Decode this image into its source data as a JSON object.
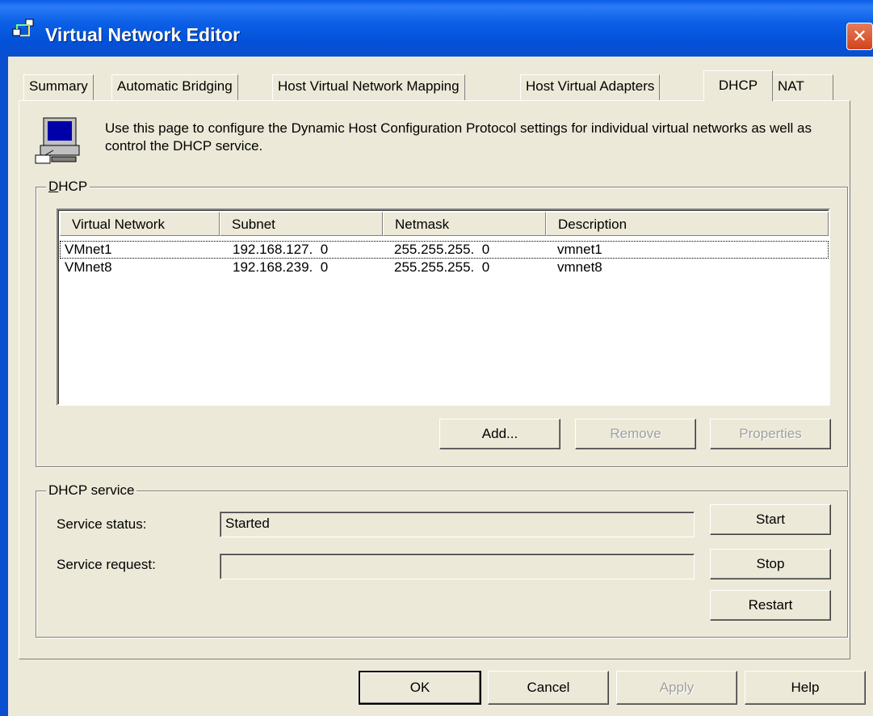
{
  "window": {
    "title": "Virtual Network Editor",
    "close_glyph": "✕"
  },
  "tabs": [
    {
      "label": "Summary"
    },
    {
      "label": "Automatic Bridging"
    },
    {
      "label": "Host Virtual Network Mapping"
    },
    {
      "label": "Host Virtual Adapters"
    },
    {
      "label": "DHCP"
    },
    {
      "label": "NAT"
    }
  ],
  "active_tab": "DHCP",
  "intro": {
    "icon": "network-computer-icon",
    "text": "Use this page to configure the Dynamic Host Configuration Protocol settings for individual virtual networks as well as control the DHCP service."
  },
  "dhcp_group": {
    "legend": "DHCP",
    "columns": [
      "Virtual Network",
      "Subnet",
      "Netmask",
      "Description"
    ],
    "rows": [
      {
        "network": "VMnet1",
        "subnet": "192.168.127.  0",
        "netmask": "255.255.255.  0",
        "description": "vmnet1"
      },
      {
        "network": "VMnet8",
        "subnet": "192.168.239.  0",
        "netmask": "255.255.255.  0",
        "description": "vmnet8"
      }
    ],
    "buttons": {
      "add": "Add...",
      "remove": "Remove",
      "properties": "Properties"
    }
  },
  "service_group": {
    "legend": "DHCP service",
    "status_label": "Service status:",
    "status_value": "Started",
    "request_label": "Service request:",
    "request_value": "",
    "buttons": {
      "start": "Start",
      "stop": "Stop",
      "restart": "Restart"
    }
  },
  "footer": {
    "ok": "OK",
    "cancel": "Cancel",
    "apply": "Apply",
    "help": "Help"
  },
  "colors": {
    "titlebar": "#0a5ee8",
    "dialog": "#ece9d8",
    "close": "#d2431a"
  }
}
